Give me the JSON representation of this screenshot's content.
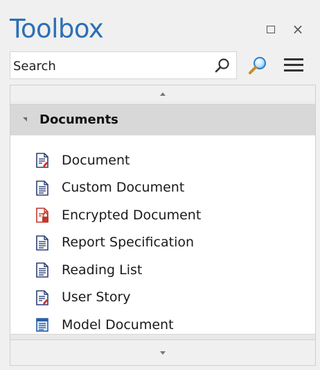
{
  "window": {
    "title": "Toolbox",
    "maximize_icon": "maximize-icon",
    "close_icon": "close-icon",
    "close_glyph": "×"
  },
  "search": {
    "placeholder": "Search",
    "value": "",
    "search_icon": "magnifier-icon",
    "find_icon": "find-magnifier-icon",
    "menu_icon": "hamburger-menu-icon"
  },
  "section": {
    "title": "Documents",
    "expanded": true,
    "items": [
      {
        "label": "Document",
        "icon": "document-icon"
      },
      {
        "label": "Custom Document",
        "icon": "custom-document-icon"
      },
      {
        "label": "Encrypted Document",
        "icon": "encrypted-document-icon"
      },
      {
        "label": "Report Specification",
        "icon": "report-specification-icon"
      },
      {
        "label": "Reading List",
        "icon": "reading-list-icon"
      },
      {
        "label": "User Story",
        "icon": "user-story-icon"
      },
      {
        "label": "Model Document",
        "icon": "model-document-icon"
      }
    ]
  },
  "colors": {
    "title": "#2d6fb6",
    "section_header_bg": "#d8d8d8",
    "panel_bg": "#ffffff",
    "window_bg": "#f0f0f0"
  }
}
